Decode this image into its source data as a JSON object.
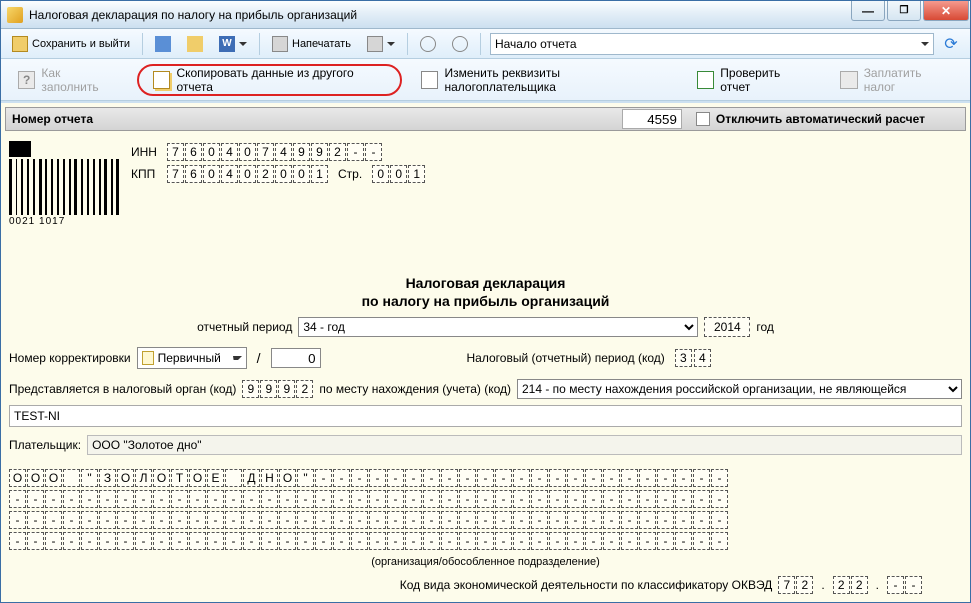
{
  "window": {
    "title": "Налоговая декларация по налогу на прибыль организаций"
  },
  "toolbar": {
    "save_exit": "Сохранить и выйти",
    "print": "Напечатать",
    "report_start": "Начало отчета",
    "word_label": "W"
  },
  "actions": {
    "how_fill": "Как заполнить",
    "copy_data": "Скопировать данные из другого отчета",
    "change_req": "Изменить реквизиты налогоплательщика",
    "check": "Проверить отчет",
    "pay": "Заплатить налог"
  },
  "header_row": {
    "label": "Номер отчета",
    "number": "4559",
    "checkbox_label": "Отключить автоматический расчет"
  },
  "ids": {
    "inn_label": "ИНН",
    "inn": [
      "7",
      "6",
      "0",
      "4",
      "0",
      "7",
      "4",
      "9",
      "9",
      "2",
      "-",
      "-"
    ],
    "kpp_label": "КПП",
    "kpp": [
      "7",
      "6",
      "0",
      "4",
      "0",
      "2",
      "0",
      "0",
      "1"
    ],
    "page_label": "Стр.",
    "page": [
      "0",
      "0",
      "1"
    ],
    "barcode_text": "0021 1017"
  },
  "doc": {
    "title1": "Налоговая декларация",
    "title2": "по налогу на прибыль организаций",
    "period_label": "отчетный период",
    "period_value": "34 - год",
    "year": "2014",
    "year_suffix": "год",
    "correction_label": "Номер корректировки",
    "correction_dd": "Первичный",
    "correction_num": "0",
    "tax_period_label": "Налоговый (отчетный) период (код)",
    "tax_period_code": [
      "3",
      "4"
    ],
    "org_label": "Представляется в налоговый орган (код)",
    "org_code": [
      "9",
      "9",
      "9",
      "2"
    ],
    "place_label": "по месту нахождения (учета) (код)",
    "place_value": "214 - по месту нахождения российской организации, не являющейся",
    "test_value": "TEST-NI",
    "payer_label": "Плательщик:",
    "payer_value": "ООО \"Золотое дно\"",
    "org_caption": "(организация/обособленное подразделение)",
    "okved_label": "Код вида экономической деятельности по классификатору ОКВЭД",
    "okved": {
      "a": [
        "7",
        "2"
      ],
      "b": [
        "2",
        "2"
      ],
      "c": [
        "-",
        "-"
      ]
    }
  },
  "name_grid_row1": [
    "О",
    "О",
    "О",
    "",
    "\"",
    "З",
    "О",
    "Л",
    "О",
    "Т",
    "О",
    "Е",
    "",
    "Д",
    "Н",
    "О",
    "\"",
    "-",
    "-",
    "-",
    "-",
    "-",
    "-",
    "-",
    "-",
    "-",
    "-",
    "-",
    "-",
    "-",
    "-",
    "-",
    "-",
    "-",
    "-",
    "-",
    "-",
    "-",
    "-",
    "-"
  ],
  "dash_row": [
    "-",
    "-",
    "-",
    "-",
    "-",
    "-",
    "-",
    "-",
    "-",
    "-",
    "-",
    "-",
    "-",
    "-",
    "-",
    "-",
    "-",
    "-",
    "-",
    "-",
    "-",
    "-",
    "-",
    "-",
    "-",
    "-",
    "-",
    "-",
    "-",
    "-",
    "-",
    "-",
    "-",
    "-",
    "-",
    "-",
    "-",
    "-",
    "-",
    "-"
  ]
}
